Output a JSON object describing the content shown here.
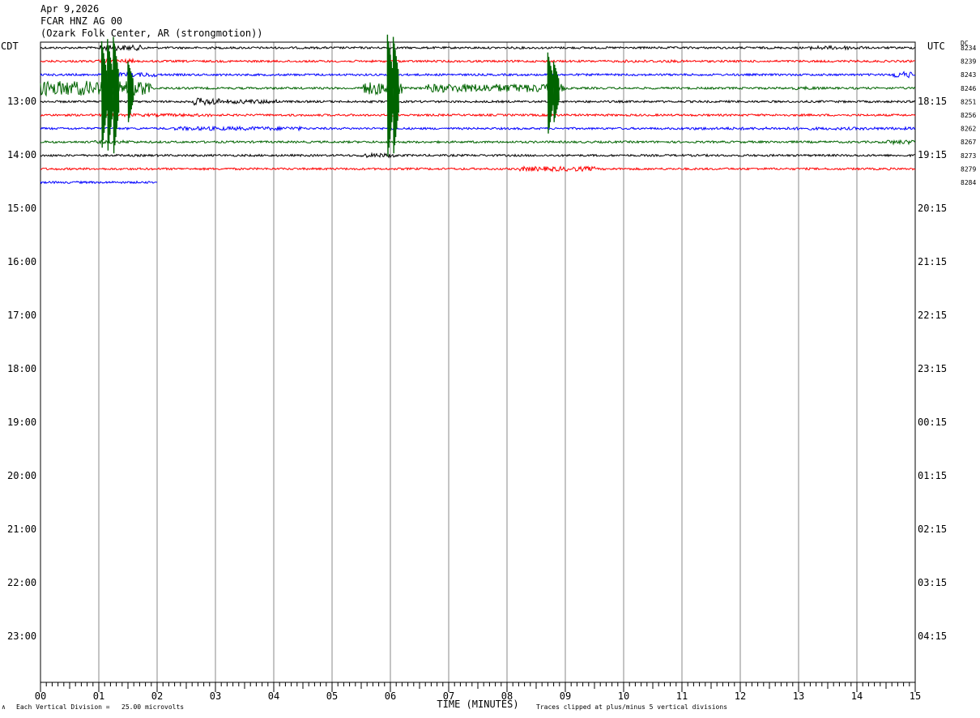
{
  "header": {
    "date": "Apr 9,2026",
    "station": "FCAR HNZ AG 00",
    "location": "(Ozark Folk Center, AR (strongmotion))"
  },
  "left_timezone": "CDT",
  "right_timezone": "UTC",
  "dc_label": "DC",
  "footer": {
    "scale_note": "Each Vertical Division =   25.00 microvolts",
    "clip_note": "Traces clipped at plus/minus 5 vertical divisions",
    "corner_mark": "∧"
  },
  "chart_data": {
    "type": "line",
    "title": "FCAR HNZ AG 00",
    "xlabel": "TIME (MINUTES)",
    "ylabel": "",
    "x_ticks": [
      "00",
      "01",
      "02",
      "03",
      "04",
      "05",
      "06",
      "07",
      "08",
      "09",
      "10",
      "11",
      "12",
      "13",
      "14",
      "15"
    ],
    "xlim": [
      0,
      15
    ],
    "grid": true,
    "left_hour_labels": [
      "13:00",
      "14:00",
      "15:00",
      "16:00",
      "17:00",
      "18:00",
      "19:00",
      "20:00",
      "21:00",
      "22:00",
      "23:00"
    ],
    "right_hour_labels": [
      "18:15",
      "19:15",
      "20:15",
      "21:15",
      "22:15",
      "23:15",
      "00:15",
      "01:15",
      "02:15",
      "03:15",
      "04:15"
    ],
    "trace_colors": [
      "#000000",
      "#ff0000",
      "#0000ff",
      "#006400"
    ],
    "traces": [
      {
        "dc_offset": "8234",
        "color": "#000000",
        "minutes_recorded": 15
      },
      {
        "dc_offset": "8239",
        "color": "#ff0000",
        "minutes_recorded": 15
      },
      {
        "dc_offset": "8243",
        "color": "#0000ff",
        "minutes_recorded": 15
      },
      {
        "dc_offset": "8246",
        "color": "#006400",
        "minutes_recorded": 15
      },
      {
        "dc_offset": "8251",
        "color": "#000000",
        "minutes_recorded": 15
      },
      {
        "dc_offset": "8256",
        "color": "#ff0000",
        "minutes_recorded": 15
      },
      {
        "dc_offset": "8262",
        "color": "#0000ff",
        "minutes_recorded": 15
      },
      {
        "dc_offset": "8267",
        "color": "#006400",
        "minutes_recorded": 15
      },
      {
        "dc_offset": "8273",
        "color": "#000000",
        "minutes_recorded": 15
      },
      {
        "dc_offset": "8279",
        "color": "#ff0000",
        "minutes_recorded": 15
      },
      {
        "dc_offset": "8284",
        "color": "#0000ff",
        "minutes_recorded": 2
      }
    ]
  }
}
